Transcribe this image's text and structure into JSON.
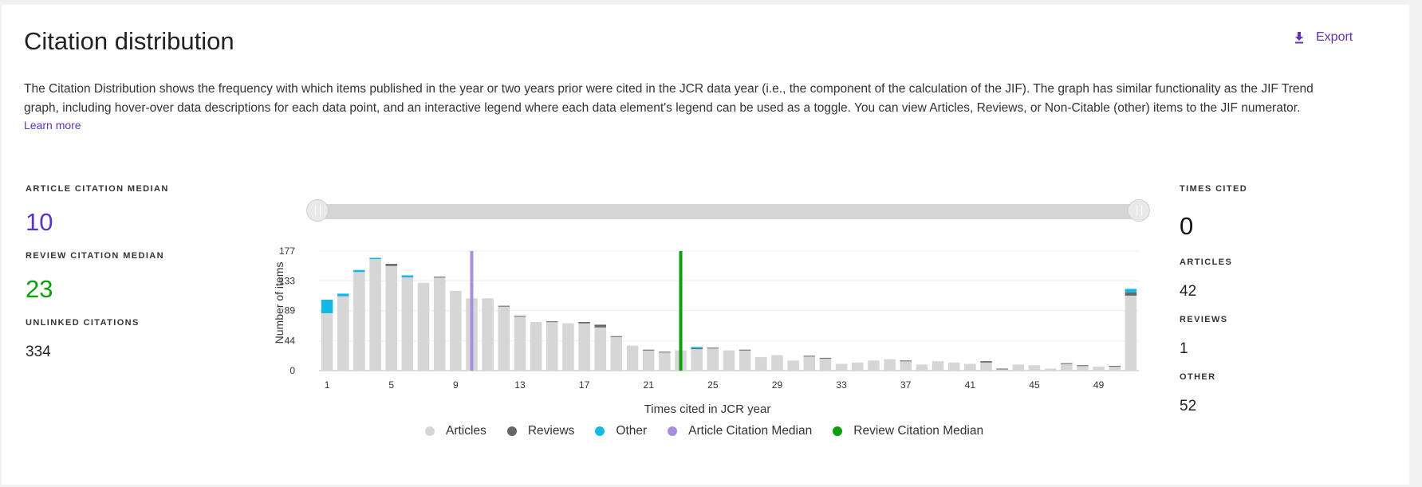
{
  "header": {
    "title": "Citation distribution",
    "export_label": "Export",
    "description": "The Citation Distribution shows the frequency with which items published in the year or two years prior were cited in the JCR data year (i.e., the component of the calculation of the JIF). The graph has similar functionality as the JIF Trend graph, including hover-over data descriptions for each data point, and an interactive legend where each data element's legend can be used as a toggle. You can view Articles, Reviews, or Non-Citable (other) items to the JIF numerator.",
    "learn_more": "Learn more"
  },
  "left_stats": {
    "article_median_label": "ARTICLE CITATION MEDIAN",
    "article_median_value": "10",
    "review_median_label": "REVIEW CITATION MEDIAN",
    "review_median_value": "23",
    "unlinked_label": "UNLINKED CITATIONS",
    "unlinked_value": "334"
  },
  "right_stats": {
    "times_cited_label": "TIMES CITED",
    "times_cited_value": "0",
    "articles_label": "ARTICLES",
    "articles_value": "42",
    "reviews_label": "REVIEWS",
    "reviews_value": "1",
    "other_label": "OTHER",
    "other_value": "52"
  },
  "colors": {
    "articles": "#d6d6d6",
    "reviews": "#666666",
    "other": "#14b8e6",
    "article_median": "#a98ee0",
    "review_median": "#0aa00a",
    "purple_text": "#5e33bf",
    "green_text": "#0aa00a"
  },
  "chart_data": {
    "type": "bar",
    "stacked": true,
    "xlabel": "Times cited in JCR year",
    "ylabel": "Number of items",
    "ylim": [
      0,
      177
    ],
    "yticks": [
      "0",
      "44",
      "89",
      "133",
      "177"
    ],
    "xticks": [
      "1",
      "5",
      "9",
      "13",
      "17",
      "21",
      "25",
      "29",
      "33",
      "37",
      "41",
      "45",
      "49"
    ],
    "categories": [
      1,
      2,
      3,
      4,
      5,
      6,
      7,
      8,
      9,
      10,
      11,
      12,
      13,
      14,
      15,
      16,
      17,
      18,
      19,
      20,
      21,
      22,
      23,
      24,
      25,
      26,
      27,
      28,
      29,
      30,
      31,
      32,
      33,
      34,
      35,
      36,
      37,
      38,
      39,
      40,
      41,
      42,
      43,
      44,
      45,
      46,
      47,
      48,
      49,
      50,
      51
    ],
    "series": [
      {
        "name": "Articles",
        "values": [
          85,
          110,
          146,
          165,
          155,
          138,
          130,
          138,
          118,
          107,
          107,
          95,
          80,
          72,
          72,
          70,
          70,
          64,
          50,
          37,
          30,
          27,
          30,
          32,
          33,
          30,
          30,
          20,
          23,
          15,
          21,
          18,
          10,
          12,
          15,
          17,
          14,
          9,
          14,
          12,
          10,
          12,
          2,
          9,
          8,
          3,
          10,
          7,
          6,
          6,
          111
        ]
      },
      {
        "name": "Reviews",
        "values": [
          0,
          0,
          0,
          0,
          3,
          0,
          0,
          1,
          0,
          0,
          0,
          1,
          1,
          0,
          1,
          0,
          2,
          4,
          1,
          0,
          1,
          1,
          0,
          1,
          1,
          0,
          1,
          0,
          0,
          0,
          1,
          1,
          0,
          0,
          0,
          0,
          1,
          0,
          0,
          0,
          0,
          2,
          1,
          0,
          0,
          0,
          1,
          1,
          0,
          1,
          5
        ]
      },
      {
        "name": "Other",
        "values": [
          20,
          4,
          3,
          2,
          0,
          3,
          0,
          0,
          0,
          0,
          0,
          0,
          0,
          0,
          0,
          0,
          0,
          0,
          0,
          0,
          0,
          0,
          0,
          2,
          0,
          0,
          0,
          0,
          0,
          0,
          0,
          0,
          0,
          0,
          0,
          0,
          0,
          0,
          0,
          0,
          0,
          0,
          0,
          0,
          0,
          0,
          0,
          0,
          0,
          0,
          5
        ]
      }
    ],
    "article_citation_median": 10,
    "review_citation_median": 23,
    "legend": [
      "Articles",
      "Reviews",
      "Other",
      "Article Citation Median",
      "Review Citation Median"
    ],
    "legend_position": "bottom"
  }
}
